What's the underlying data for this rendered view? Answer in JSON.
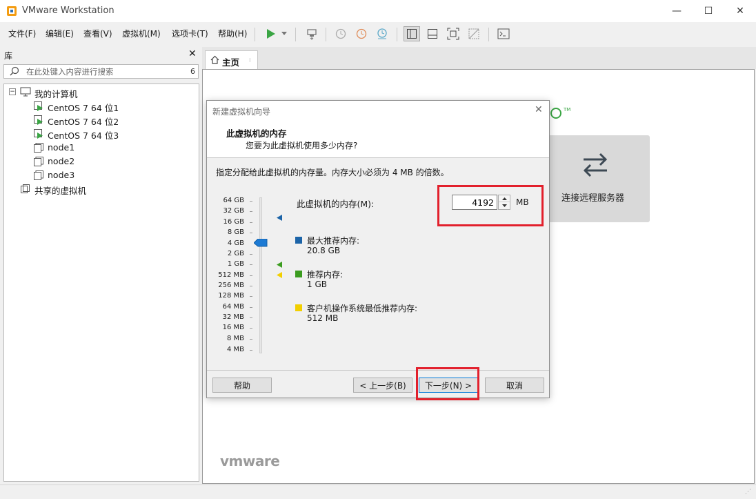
{
  "window": {
    "title": "VMware Workstation",
    "controls": [
      "minimize",
      "maximize",
      "close"
    ]
  },
  "menu": [
    "文件(F)",
    "编辑(E)",
    "查看(V)",
    "虚拟机(M)",
    "选项卡(T)",
    "帮助(H)"
  ],
  "toolbar": {
    "icons": [
      "play-icon",
      "dropdown-arrow-icon",
      "send-ctrl-alt-del-icon",
      "snapshot-icon",
      "revert-snapshot-icon",
      "snapshot-manager-icon",
      "library-view-icon",
      "thumbnail-bar-icon",
      "fullscreen-icon",
      "unity-icon",
      "console-icon"
    ]
  },
  "library": {
    "title": "库",
    "search_placeholder": "在此处键入内容进行搜索",
    "search_count": "6",
    "tree": {
      "root": "我的计算机",
      "items": [
        "CentOS 7 64 位1",
        "CentOS 7 64 位2",
        "CentOS 7 64 位3",
        "node1",
        "node2",
        "node3"
      ],
      "shared": "共享的虚拟机"
    }
  },
  "tabs": [
    {
      "label": "主页"
    }
  ],
  "home": {
    "remote_server_label": "连接远程服务器",
    "logo": "vmware"
  },
  "dialog": {
    "title": "新建虚拟机向导",
    "heading": "此虚拟机的内存",
    "subheading": "您要为此虚拟机使用多少内存?",
    "instruction": "指定分配给此虚拟机的内存量。内存大小必须为 4 MB 的倍数。",
    "scale": [
      "64 GB",
      "32 GB",
      "16 GB",
      "8 GB",
      "4 GB",
      "2 GB",
      "1 GB",
      "512 MB",
      "256 MB",
      "128 MB",
      "64 MB",
      "32 MB",
      "16 MB",
      "8 MB",
      "4 MB"
    ],
    "memory_label": "此虚拟机的内存(M):",
    "memory_value": "4192",
    "memory_unit": "MB",
    "legend": [
      {
        "title": "最大推荐内存:",
        "value": "20.8 GB",
        "color": "#1c64a8"
      },
      {
        "title": "推荐内存:",
        "value": "1 GB",
        "color": "#3b9c1f"
      },
      {
        "title": "客户机操作系统最低推荐内存:",
        "value": "512 MB",
        "color": "#f2cf00"
      }
    ],
    "buttons": {
      "help": "帮助",
      "back": "< 上一步(B)",
      "next": "下一步(N) >",
      "cancel": "取消"
    }
  },
  "colors": {
    "highlight": "#e2202c",
    "accent": "#1c64a8"
  }
}
